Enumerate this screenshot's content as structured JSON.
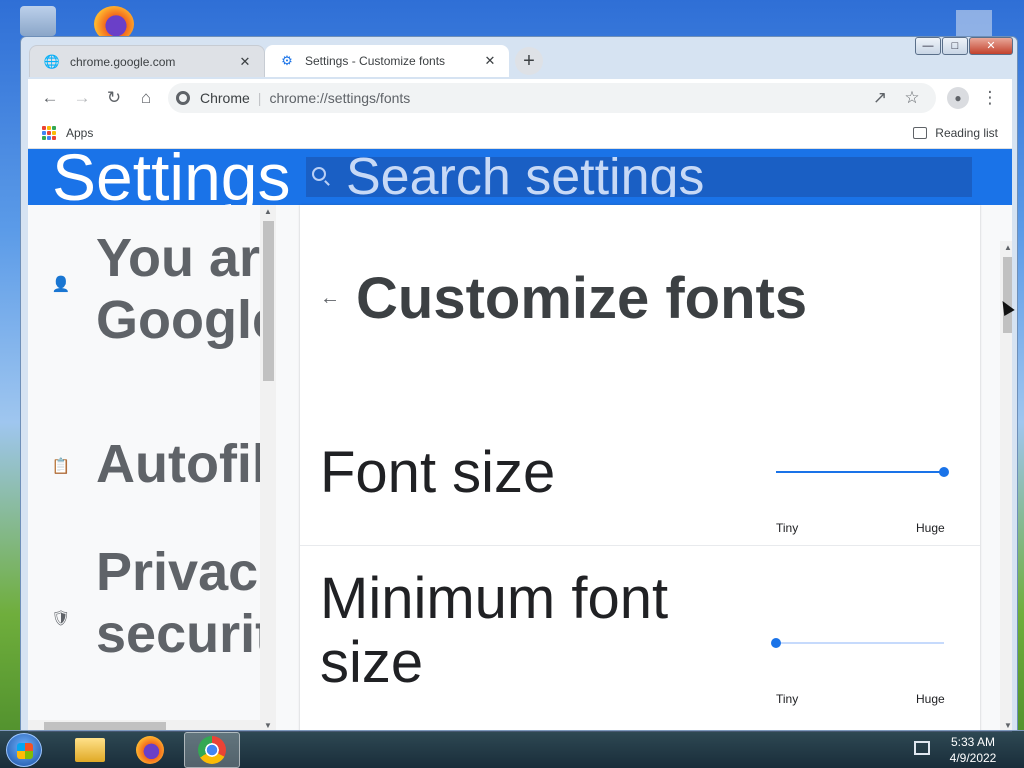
{
  "browser": {
    "tabs": [
      {
        "title": "chrome.google.com",
        "icon": "globe-icon"
      },
      {
        "title": "Settings - Customize fonts",
        "icon": "gear-icon"
      }
    ],
    "omnibox": {
      "site": "Chrome",
      "url": "chrome://settings/fonts"
    },
    "bookmarks": {
      "apps": "Apps",
      "reading_list": "Reading list"
    }
  },
  "settings": {
    "header_title": "Settings",
    "search_placeholder": "Search settings",
    "sidebar": [
      {
        "icon": "person-icon",
        "label_line1": "You ar",
        "label_line2": "Google"
      },
      {
        "icon": "clipboard-icon",
        "label_line1": "Autofil"
      },
      {
        "icon": "shield-icon",
        "label_line1": "Privac",
        "label_line2": "securit"
      }
    ],
    "page_title": "Customize fonts",
    "font_size": {
      "label": "Font size",
      "min_label": "Tiny",
      "max_label": "Huge",
      "value_fraction": 1.0
    },
    "minimum_font_size": {
      "label_line1": "Minimum font",
      "label_line2": "size",
      "min_label": "Tiny",
      "max_label": "Huge",
      "value_fraction": 0.0
    }
  },
  "taskbar": {
    "time": "5:33 AM",
    "date": "4/9/2022"
  },
  "colors": {
    "accent": "#1a73e8",
    "header_bg": "#1a73e8"
  }
}
